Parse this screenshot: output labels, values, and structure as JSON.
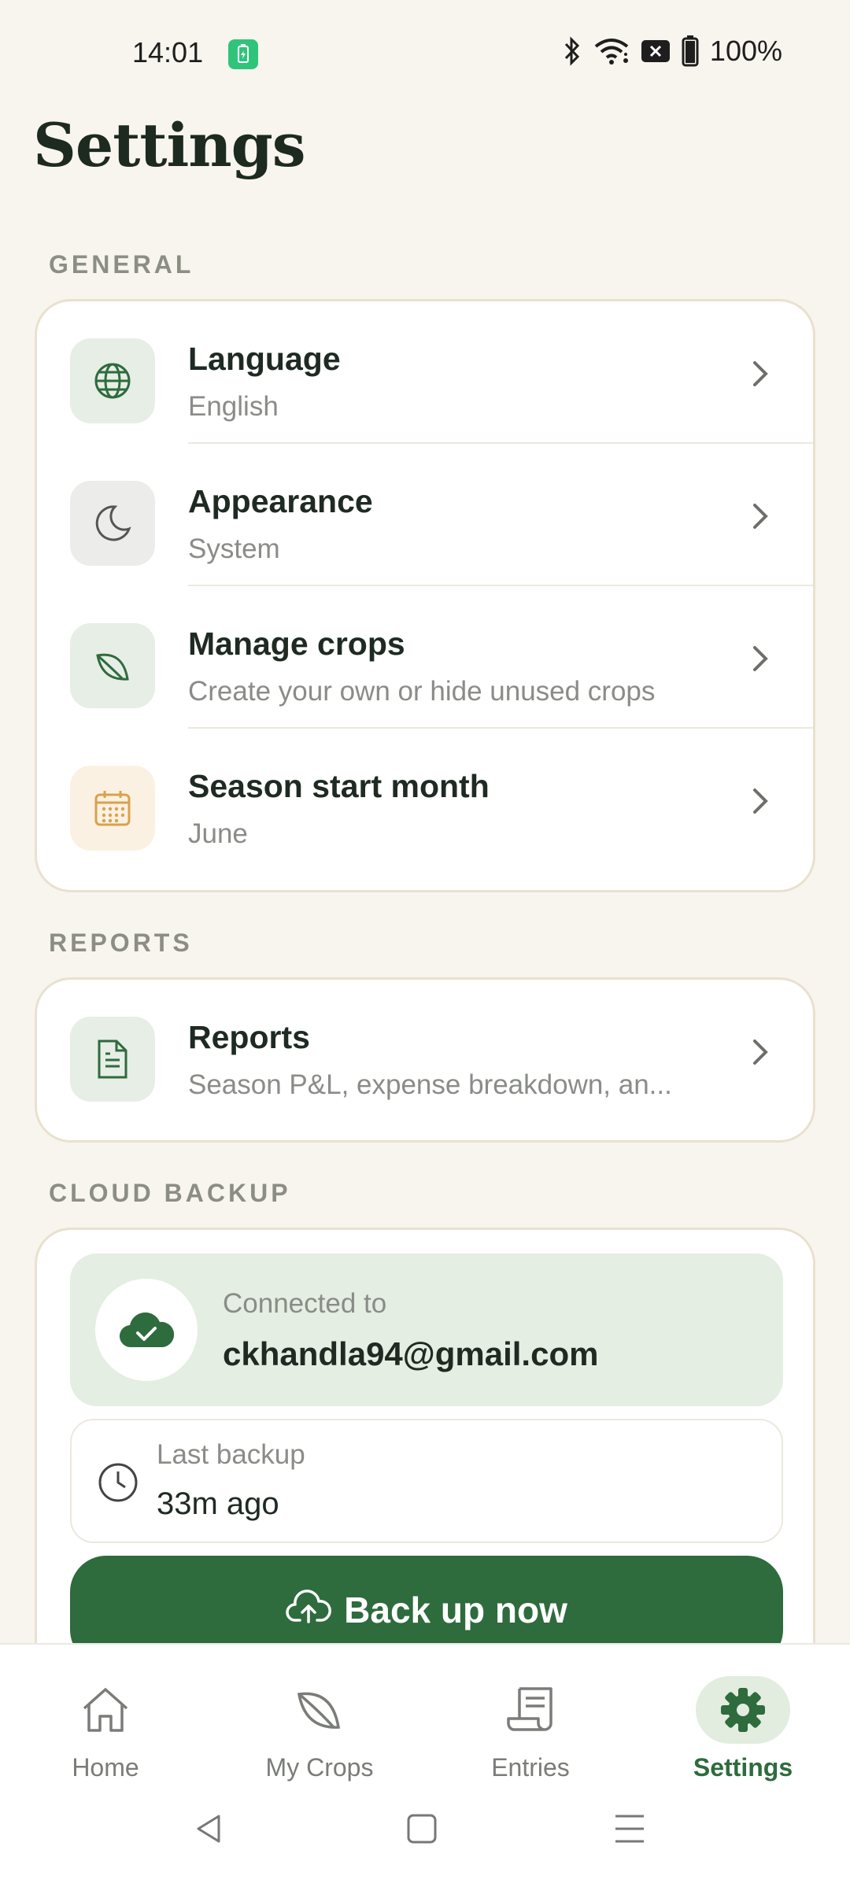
{
  "status_bar": {
    "time": "14:01",
    "battery_pct": "100%"
  },
  "page": {
    "title": "Settings"
  },
  "general": {
    "section_label": "GENERAL",
    "items": [
      {
        "title": "Language",
        "subtitle": "English",
        "icon": "globe-icon"
      },
      {
        "title": "Appearance",
        "subtitle": "System",
        "icon": "moon-icon"
      },
      {
        "title": "Manage crops",
        "subtitle": "Create your own or hide unused crops",
        "icon": "leaf-icon"
      },
      {
        "title": "Season start month",
        "subtitle": "June",
        "icon": "calendar-icon"
      }
    ]
  },
  "reports": {
    "section_label": "REPORTS",
    "item": {
      "title": "Reports",
      "subtitle": "Season P&L, expense breakdown, an...",
      "icon": "document-icon"
    }
  },
  "cloud_backup": {
    "section_label": "CLOUD BACKUP",
    "connected_label": "Connected to",
    "email": "ckhandla94@gmail.com",
    "last_backup_label": "Last backup",
    "last_backup_value": "33m ago",
    "backup_button_label": "Back up now"
  },
  "bottom_nav": {
    "items": [
      {
        "label": "Home",
        "icon": "home-icon",
        "active": false
      },
      {
        "label": "My Crops",
        "icon": "leaf-icon",
        "active": false
      },
      {
        "label": "Entries",
        "icon": "receipt-icon",
        "active": false
      },
      {
        "label": "Settings",
        "icon": "gear-icon",
        "active": true
      }
    ]
  },
  "colors": {
    "background": "#F8F5EE",
    "accent": "#2E6B3D",
    "accent_light": "#E4EEE2",
    "warm_icon": "#D9A24C"
  }
}
